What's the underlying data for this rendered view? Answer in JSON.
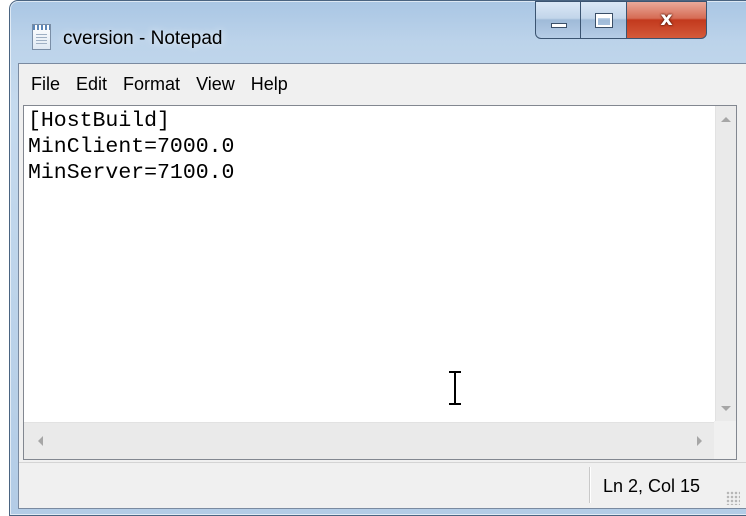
{
  "window": {
    "title": "cversion - Notepad",
    "close_glyph": "x"
  },
  "menu": {
    "items": [
      {
        "label": "File"
      },
      {
        "label": "Edit"
      },
      {
        "label": "Format"
      },
      {
        "label": "View"
      },
      {
        "label": "Help"
      }
    ]
  },
  "document": {
    "lines": [
      "[HostBuild]",
      "MinClient=7000.0",
      "MinServer=7100.0"
    ]
  },
  "status": {
    "position": "Ln 2, Col 15"
  },
  "icons": {
    "app": "notepad-icon",
    "minimize": "minimize-icon",
    "maximize": "maximize-icon",
    "close": "close-icon",
    "cursor": "text-cursor-icon"
  },
  "colors": {
    "close_button": "#c2391d",
    "frame": "#bcd3ea"
  }
}
